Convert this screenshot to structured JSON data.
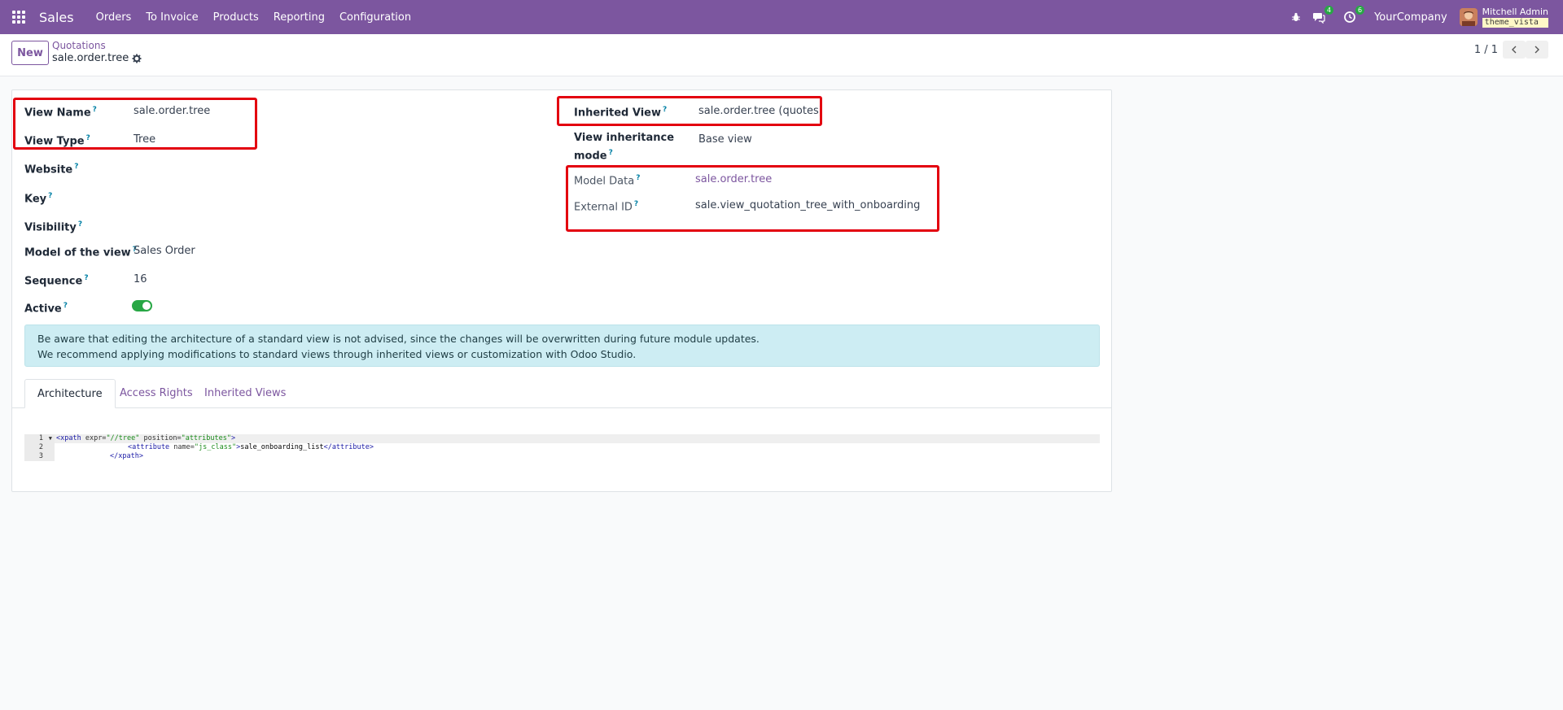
{
  "navbar": {
    "brand": "Sales",
    "menu": [
      "Orders",
      "To Invoice",
      "Products",
      "Reporting",
      "Configuration"
    ],
    "chat_count": "4",
    "activity_count": "6",
    "company": "YourCompany",
    "user_name": "Mitchell Admin",
    "db_name": "theme_vista",
    "accent_color": "#7c569f"
  },
  "control": {
    "new_label": "New",
    "breadcrumb_parent": "Quotations",
    "breadcrumb_current": "sale.order.tree",
    "pager_value": "1 / 1"
  },
  "form": {
    "view_name_label": "View Name",
    "view_name": "sale.order.tree",
    "view_type_label": "View Type",
    "view_type": "Tree",
    "website_label": "Website",
    "key_label": "Key",
    "visibility_label": "Visibility",
    "model_label": "Model of the view",
    "model": "Sales Order",
    "sequence_label": "Sequence",
    "sequence": "16",
    "active_label": "Active",
    "active": true,
    "inherited_view_label": "Inherited View",
    "inherited_view": "sale.order.tree (quotes)",
    "inheritance_mode_label_1": "View inheritance",
    "inheritance_mode_label_2": "mode",
    "inheritance_mode": "Base view",
    "model_data_label": "Model Data",
    "model_data": "sale.order.tree",
    "external_id_label": "External ID",
    "external_id": "sale.view_quotation_tree_with_onboarding",
    "help_mark": "?"
  },
  "alert": {
    "line1": "Be aware that editing the architecture of a standard view is not advised, since the changes will be overwritten during future module updates.",
    "line2": "We recommend applying modifications to standard views through inherited views or customization with Odoo Studio."
  },
  "tabs": [
    "Architecture",
    "Access Rights",
    "Inherited Views"
  ],
  "code": {
    "line_numbers": [
      "1",
      "2",
      "3"
    ],
    "l1_open": "<xpath",
    "l1_attr1": " expr=",
    "l1_val1": "\"//tree\"",
    "l1_attr2": " position=",
    "l1_val2": "\"attributes\"",
    "l1_close": ">",
    "l2_open": "<attribute",
    "l2_attr": " name=",
    "l2_val": "\"js_class\"",
    "l2_gt": ">",
    "l2_text": "sale_onboarding_list",
    "l2_close": "</attribute>",
    "l3_close": "</xpath>"
  },
  "colors": {
    "highlight": "#e3000f",
    "alert_bg": "#cdedf3",
    "toggle_on": "#28a745"
  }
}
